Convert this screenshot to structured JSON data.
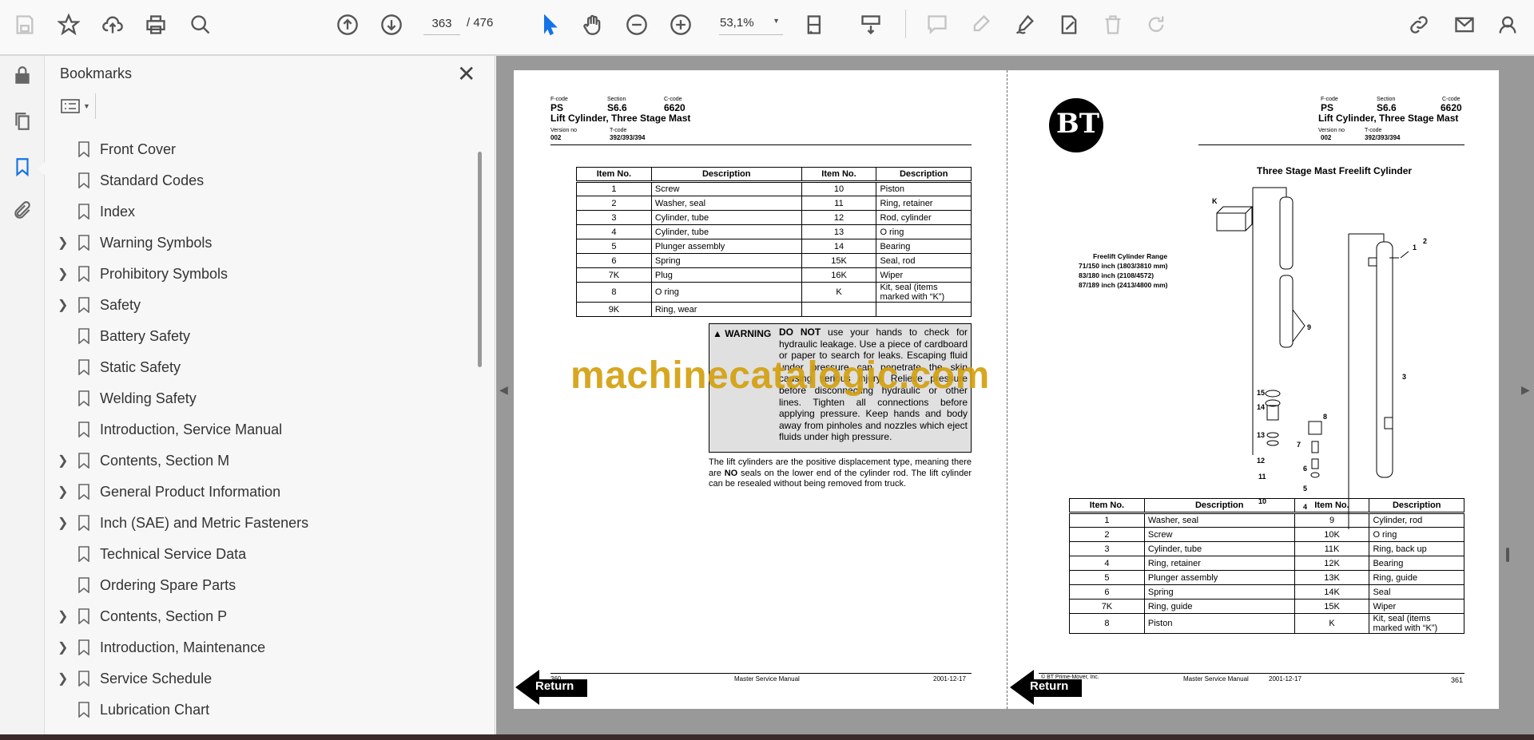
{
  "toolbar": {
    "page_current": "363",
    "page_total": "/ 476",
    "zoom": "53,1%"
  },
  "bookmarks": {
    "title": "Bookmarks",
    "items": [
      {
        "label": "Front Cover",
        "expandable": false
      },
      {
        "label": "Standard Codes",
        "expandable": false
      },
      {
        "label": "Index",
        "expandable": false
      },
      {
        "label": "Warning Symbols",
        "expandable": true
      },
      {
        "label": "Prohibitory Symbols",
        "expandable": true
      },
      {
        "label": "Safety",
        "expandable": true
      },
      {
        "label": "Battery Safety",
        "expandable": false
      },
      {
        "label": "Static Safety",
        "expandable": false
      },
      {
        "label": "Welding Safety",
        "expandable": false
      },
      {
        "label": "Introduction, Service Manual",
        "expandable": false
      },
      {
        "label": "Contents, Section M",
        "expandable": true
      },
      {
        "label": "General Product Information",
        "expandable": true
      },
      {
        "label": "Inch (SAE) and Metric Fasteners",
        "expandable": true
      },
      {
        "label": "Technical Service Data",
        "expandable": false
      },
      {
        "label": "Ordering Spare Parts",
        "expandable": false
      },
      {
        "label": "Contents, Section P",
        "expandable": true
      },
      {
        "label": "Introduction, Maintenance",
        "expandable": true
      },
      {
        "label": "Service Schedule",
        "expandable": true
      },
      {
        "label": "Lubrication Chart",
        "expandable": false
      }
    ]
  },
  "header": {
    "fcode_label": "F-code",
    "fcode": "PS",
    "section_label": "Section",
    "section": "S6.6",
    "ccode_label": "C-code",
    "ccode": "6620",
    "title": "Lift Cylinder, Three Stage Mast",
    "version_label": "Version no",
    "version": "002",
    "tcode_label": "T-code",
    "tcode": "392/393/394"
  },
  "left_page": {
    "table_headers": [
      "Item No.",
      "Description",
      "Item No.",
      "Description"
    ],
    "rows": [
      [
        "1",
        "Screw",
        "10",
        "Piston"
      ],
      [
        "2",
        "Washer, seal",
        "11",
        "Ring, retainer"
      ],
      [
        "3",
        "Cylinder, tube",
        "12",
        "Rod, cylinder"
      ],
      [
        "4",
        "Cylinder, tube",
        "13",
        "O ring"
      ],
      [
        "5",
        "Plunger assembly",
        "14",
        "Bearing"
      ],
      [
        "6",
        "Spring",
        "15K",
        "Seal, rod"
      ],
      [
        "7K",
        "Plug",
        "16K",
        "Wiper"
      ],
      [
        "8",
        "O ring",
        "K",
        "Kit, seal (items marked with “K”)"
      ],
      [
        "9K",
        "Ring, wear",
        "",
        ""
      ]
    ],
    "warning_label": "WARNING",
    "warning_bold": "DO NOT",
    "warning_text": " use your hands to check for hydraulic leakage. Use a piece of cardboard or paper to search for leaks. Escaping fluid under pressure can penetrate the skin causing serious injury. Relieve pressure before disconnecting hydraulic or other lines. Tighten all connections before applying pressure. Keep hands and body away from pinholes and nozzles which eject fluids under high pressure.",
    "para_a": "The lift cylinders are the positive displacement type, meaning there are ",
    "para_bold": "NO",
    "para_b": " seals on the lower end of the cylinder rod. The lift cylinder can be resealed without being removed from truck.",
    "footer_page": "360",
    "footer_manual": "Master Service Manual",
    "footer_date": "2001-12-17"
  },
  "right_page": {
    "logo": "BT",
    "diagram_title": "Three Stage Mast Freelift Cylinder",
    "range_title": "Freelift Cylinder Range",
    "ranges": [
      "71/150 inch (1803/3810 mm)",
      "83/180 inch (2108/4572)",
      "87/189 inch (2413/4800 mm)"
    ],
    "callouts": [
      "K",
      "1",
      "2",
      "3",
      "9",
      "15",
      "14",
      "13",
      "12",
      "11",
      "10",
      "8",
      "7",
      "6",
      "5",
      "4"
    ],
    "table_headers": [
      "Item No.",
      "Description",
      "Item No.",
      "Description"
    ],
    "rows": [
      [
        "1",
        "Washer, seal",
        "9",
        "Cylinder, rod"
      ],
      [
        "2",
        "Screw",
        "10K",
        "O ring"
      ],
      [
        "3",
        "Cylinder, tube",
        "11K",
        "Ring, back up"
      ],
      [
        "4",
        "Ring, retainer",
        "12K",
        "Bearing"
      ],
      [
        "5",
        "Plunger assembly",
        "13K",
        "Ring, guide"
      ],
      [
        "6",
        "Spring",
        "14K",
        "Seal"
      ],
      [
        "7K",
        "Ring, guide",
        "15K",
        "Wiper"
      ],
      [
        "8",
        "Piston",
        "K",
        "Kit, seal (items marked with “K”)"
      ]
    ],
    "footer_copyright": "© BT Prime-Mover, Inc.",
    "footer_manual": "Master Service Manual",
    "footer_date": "2001-12-17",
    "footer_page": "361"
  },
  "return_label": "Return",
  "watermark": "machinecatalogic.com",
  "colors": {
    "accent": "#1473e6",
    "watermark": "#d4a00f"
  }
}
